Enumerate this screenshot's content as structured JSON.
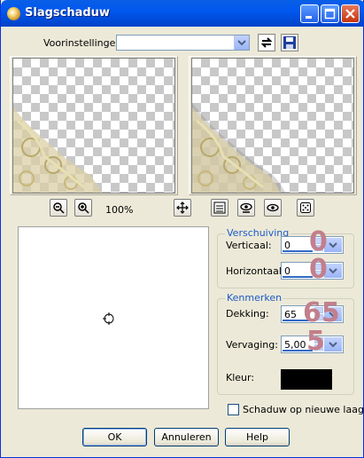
{
  "window": {
    "title": "Slagschaduw"
  },
  "presets": {
    "label": "Voorinstellingen:",
    "value": ""
  },
  "zoom": {
    "level": "100%"
  },
  "verschuiving": {
    "title": "Verschuiving",
    "vertical_label": "Verticaal:",
    "vertical_value": "0",
    "horizontal_label": "Horizontaal:",
    "horizontal_value": "0",
    "vertical_marker": "0",
    "horizontal_marker": "0"
  },
  "kenmerken": {
    "title": "Kenmerken",
    "opacity_label": "Dekking:",
    "opacity_value": "65",
    "opacity_marker": "65",
    "blur_label": "Vervaging:",
    "blur_value": "5,00",
    "blur_marker": "5",
    "color_label": "Kleur:",
    "color": "#000000"
  },
  "checkbox": {
    "label": "Schaduw op nieuwe laag",
    "checked": false
  },
  "buttons": {
    "ok": "OK",
    "cancel": "Annuleren",
    "help": "Help"
  },
  "colors": {
    "marker": "#c27f8c",
    "title_bar": "#0058ee",
    "group_title": "#1c5ac8"
  }
}
